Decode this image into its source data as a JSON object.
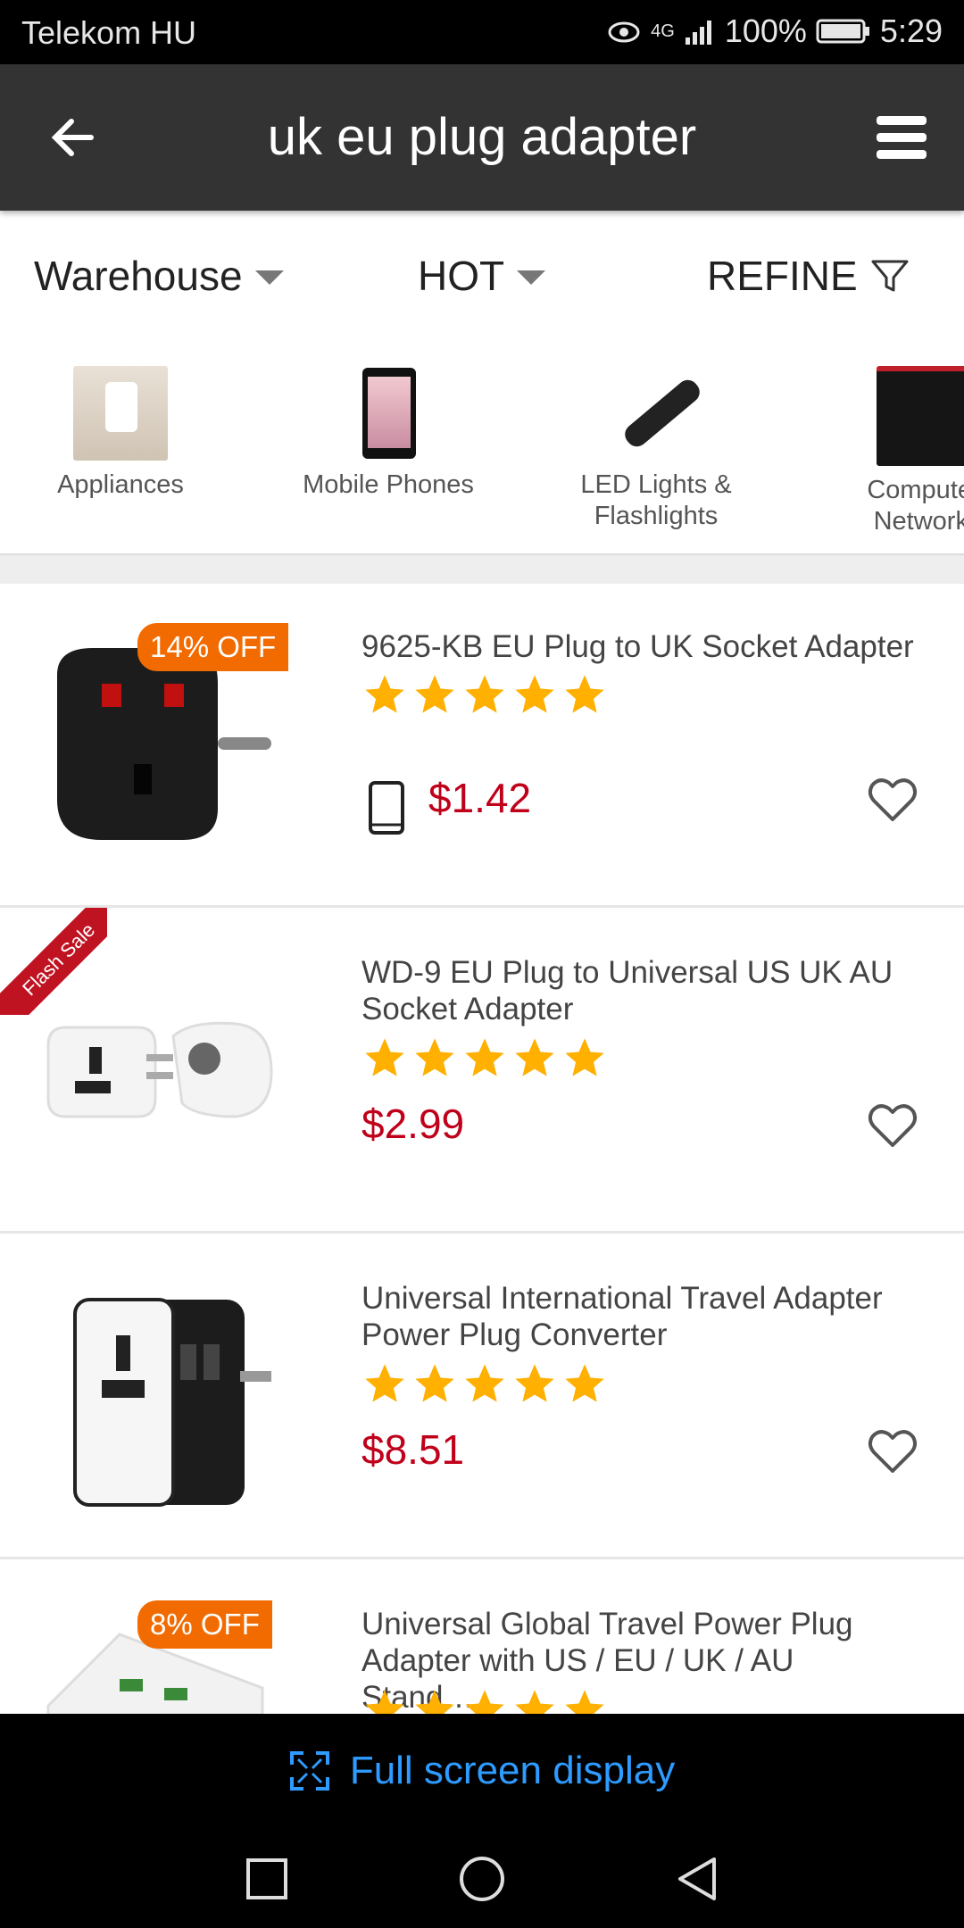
{
  "status_bar": {
    "carrier": "Telekom HU",
    "network": "4G",
    "battery": "100%",
    "time": "5:29"
  },
  "app_bar": {
    "title": "uk eu plug adapter"
  },
  "filters": {
    "warehouse": "Warehouse",
    "sort": "HOT",
    "refine": "REFINE"
  },
  "categories": [
    {
      "label": "Appliances"
    },
    {
      "label": "Mobile Phones"
    },
    {
      "label": "LED Lights &\nFlashlights"
    },
    {
      "label": "Computer\nNetworki"
    }
  ],
  "products": [
    {
      "name": "9625-KB EU Plug to UK Socket Adapter",
      "price": "$1.42",
      "badge": "14% OFF",
      "rating": 5
    },
    {
      "name": "WD-9 EU Plug to Universal US UK AU Socket Adapter",
      "price": "$2.99",
      "badge": "Flash Sale",
      "rating": 5
    },
    {
      "name": "Universal International Travel Adapter Power Plug Converter",
      "price": "$8.51",
      "badge": "",
      "rating": 5
    },
    {
      "name": "Universal Global Travel Power Plug Adapter with US / EU / UK / AU Stand…",
      "price": "",
      "badge": "8% OFF",
      "rating": 5
    }
  ],
  "fullscreen_label": "Full screen display",
  "colors": {
    "price": "#c0001a",
    "badge": "#f26b00",
    "star": "#ffb000",
    "link": "#2e9bff"
  }
}
